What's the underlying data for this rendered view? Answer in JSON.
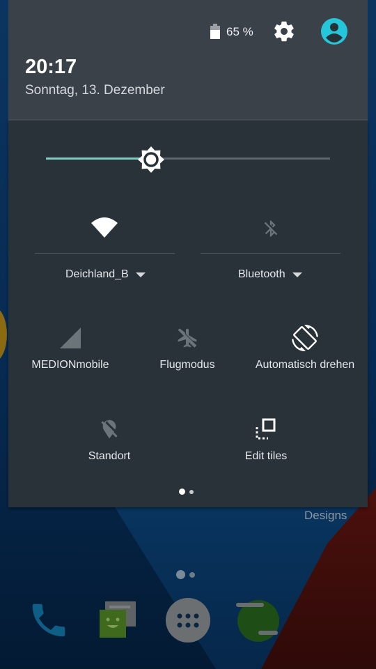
{
  "status": {
    "battery_icon": "battery-icon",
    "battery_percent": "65 %",
    "settings_icon": "gear-icon",
    "user_icon": "account-circle-icon",
    "accent_color": "#26c6da"
  },
  "header": {
    "time": "20:17",
    "date": "Sonntag, 13. Dezember"
  },
  "brightness": {
    "level": 0.37,
    "fill_color": "#80cbc4",
    "icon": "brightness-icon"
  },
  "quick_settings": {
    "dual_tiles": [
      {
        "id": "wifi",
        "label": "Deichland_B",
        "icon": "wifi-icon",
        "active": true
      },
      {
        "id": "bluetooth",
        "label": "Bluetooth",
        "icon": "bluetooth-disabled-icon",
        "active": false
      }
    ],
    "tiles": [
      {
        "id": "mobile",
        "label": "MEDIONmobile",
        "icon": "cellular-signal-icon",
        "active": false
      },
      {
        "id": "airplane",
        "label": "Flugmodus",
        "icon": "airplane-off-icon",
        "active": false
      },
      {
        "id": "rotate",
        "label": "Automatisch drehen",
        "icon": "screen-rotation-icon",
        "active": true
      },
      {
        "id": "location",
        "label": "Standort",
        "icon": "location-off-icon",
        "active": false
      },
      {
        "id": "edit",
        "label": "Edit tiles",
        "icon": "edit-tiles-icon",
        "active": true
      }
    ],
    "page_indicator": {
      "current": 1,
      "total": 2
    }
  },
  "home": {
    "folder_label": "Designs",
    "page_indicator": {
      "current": 1,
      "total": 2
    },
    "dock": [
      {
        "name": "Phone",
        "icon": "phone-icon"
      },
      {
        "name": "Messaging",
        "icon": "messaging-icon"
      },
      {
        "name": "App drawer",
        "icon": "app-drawer-icon"
      },
      {
        "name": "Hangouts",
        "icon": "hangouts-icon"
      }
    ]
  }
}
